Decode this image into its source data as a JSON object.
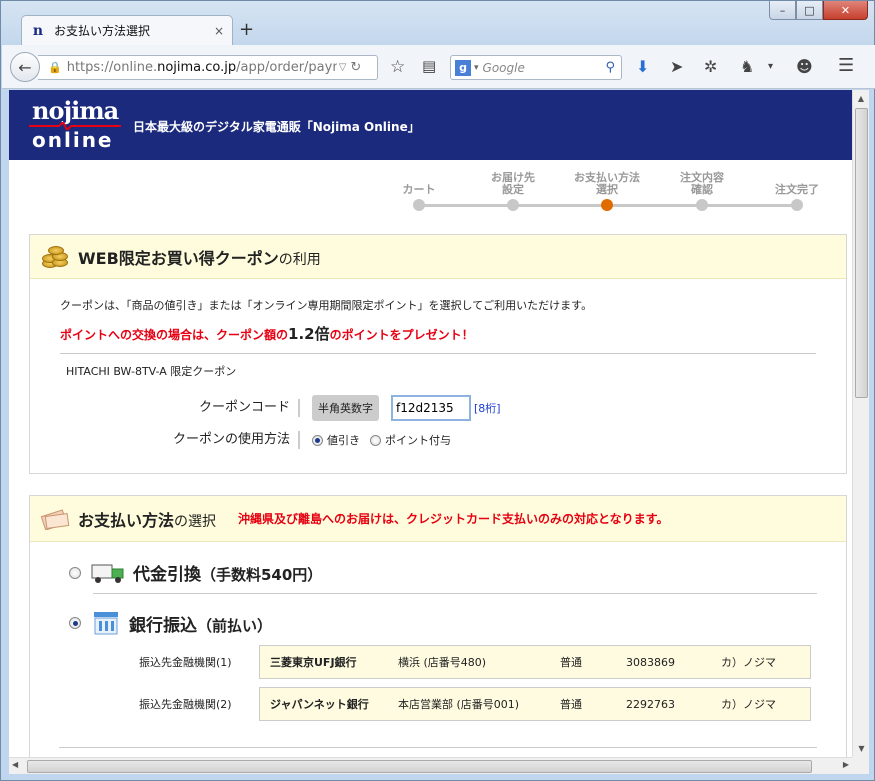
{
  "browser": {
    "tab_title": "お支払い方法選択",
    "tab_close": "×",
    "new_tab": "+",
    "url_prefix": "https://online.",
    "url_domain": "nojima.co.jp",
    "url_rest": "/app/order/payme",
    "search_placeholder": "Google",
    "window_buttons": [
      "–",
      "□",
      "✕"
    ]
  },
  "site": {
    "logo_top": "nojima",
    "logo_bottom": "online",
    "tagline": "日本最大級のデジタル家電通販「Nojima Online」"
  },
  "steps": [
    {
      "label": "カート",
      "active": false
    },
    {
      "label": "お届け先\n設定",
      "active": false
    },
    {
      "label": "お支払い方法\n選択",
      "active": true
    },
    {
      "label": "注文内容\n確認",
      "active": false
    },
    {
      "label": "注文完了",
      "active": false
    }
  ],
  "coupon": {
    "title_main": "WEB限定お買い得クーポン",
    "title_suffix": "の利用",
    "description": "クーポンは、「商品の値引き」または「オンライン専用期間限定ポイント」を選択してご利用いただけます。",
    "promo_before": "ポイントへの交換の場合は、クーポン額の",
    "promo_multiplier": "1.2倍",
    "promo_after": "のポイントをプレゼント！",
    "product": "HITACHI BW-8TV-A 限定クーポン",
    "code_label": "クーポンコード",
    "code_badge": "半角英数字",
    "code_value": "f12d2135",
    "code_digits": "[8桁]",
    "method_label": "クーポンの使用方法",
    "method_options": [
      {
        "label": "値引き",
        "selected": true
      },
      {
        "label": "ポイント付与",
        "selected": false
      }
    ]
  },
  "payment": {
    "title_main": "お支払い方法",
    "title_suffix": "の選択",
    "note": "沖縄県及び離島へのお届けは、クレジットカード支払いのみの対応となります。",
    "options": [
      {
        "title": "代金引換",
        "sub": "（手数料540円）",
        "selected": false,
        "icon": "truck-icon"
      },
      {
        "title": "銀行振込",
        "sub": "（前払い）",
        "selected": true,
        "icon": "bank-icon"
      }
    ],
    "banks": [
      {
        "label": "振込先金融機関(1)",
        "name": "三菱東京UFJ銀行",
        "branch": "横浜 (店番号480)",
        "type": "普通",
        "number": "3083869",
        "holder": "カ）ノジマ"
      },
      {
        "label": "振込先金融機関(2)",
        "name": "ジャパンネット銀行",
        "branch": "本店営業部 (店番号001)",
        "type": "普通",
        "number": "2292763",
        "holder": "カ）ノジマ"
      }
    ]
  }
}
